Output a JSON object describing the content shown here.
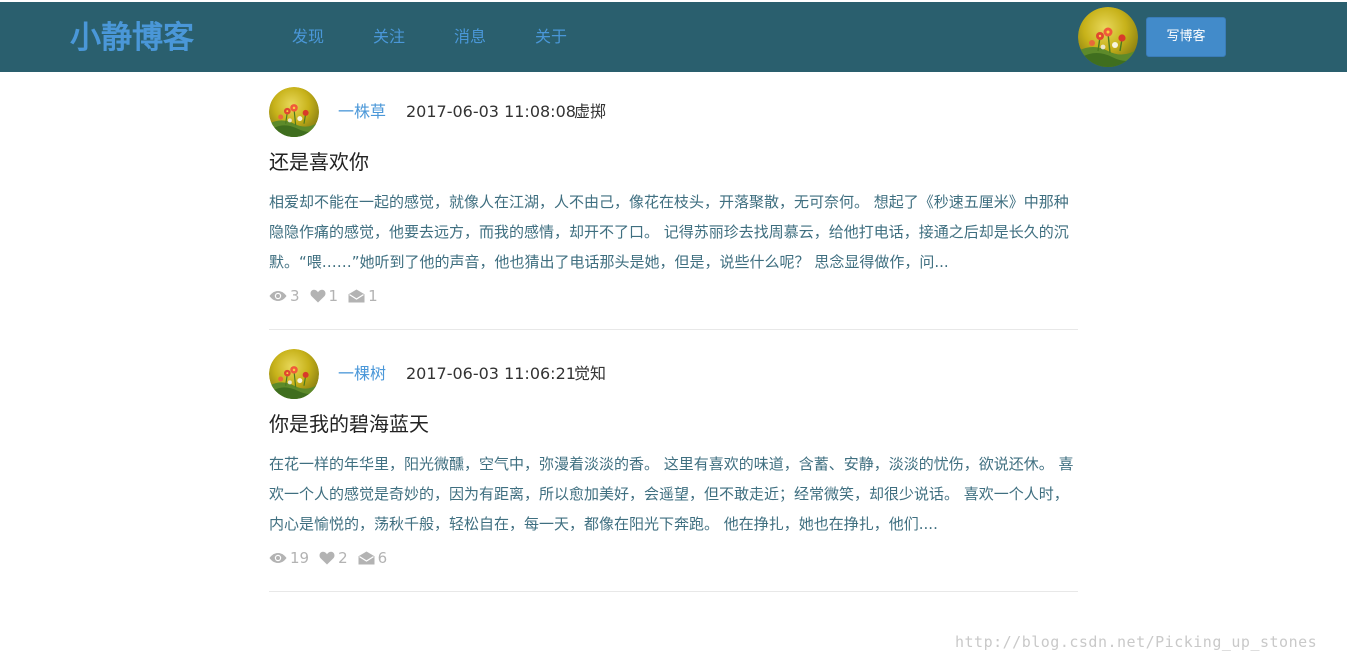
{
  "header": {
    "brand": "小静博客",
    "nav": [
      "发现",
      "关注",
      "消息",
      "关于"
    ],
    "write_button": "写博客"
  },
  "posts": [
    {
      "author": "一株草",
      "date": "2017-06-03 11:08:08",
      "category": "虚掷",
      "title": "还是喜欢你",
      "excerpt": "相爱却不能在一起的感觉，就像人在江湖，人不由己，像花在枝头，开落聚散，无可奈何。 想起了《秒速五厘米》中那种隐隐作痛的感觉，他要去远方，而我的感情，却开不了口。 记得苏丽珍去找周慕云，给他打电话，接通之后却是长久的沉默。“喂……”她听到了他的声音，他也猜出了电话那头是她，但是，说些什么呢？ 思念显得做作，问...",
      "views": "3",
      "likes": "1",
      "comments": "1"
    },
    {
      "author": "一棵树",
      "date": "2017-06-03 11:06:21",
      "category": "觉知",
      "title": "你是我的碧海蓝天",
      "excerpt": "在花一样的年华里，阳光微醺，空气中，弥漫着淡淡的香。 这里有喜欢的味道，含蓄、安静，淡淡的忧伤，欲说还休。 喜欢一个人的感觉是奇妙的，因为有距离，所以愈加美好，会遥望，但不敢走近；经常微笑，却很少说话。 喜欢一个人时，内心是愉悦的，荡秋千般，轻松自在，每一天，都像在阳光下奔跑。 他在挣扎，她也在挣扎，他们....",
      "views": "19",
      "likes": "2",
      "comments": "6"
    }
  ],
  "watermark": "http://blog.csdn.net/Picking_up_stones",
  "colors": {
    "navbar_bg": "#2a5f6e",
    "brand_blue": "#4a97d8",
    "button_blue": "#428bca",
    "excerpt_text": "#3f6f80",
    "stat_gray": "#b3b3b3"
  },
  "icons": {
    "avatar": "flower-avatar-icon",
    "views": "eye-icon",
    "likes": "heart-icon",
    "comments": "envelope-icon"
  }
}
